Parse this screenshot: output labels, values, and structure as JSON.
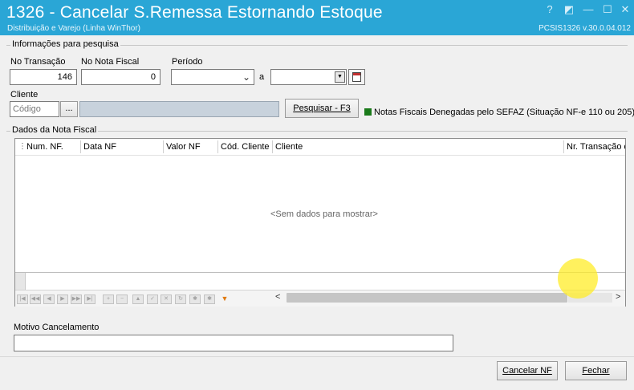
{
  "window": {
    "title": "1326 - Cancelar S.Remessa Estornando Estoque",
    "subtitle": "Distribuição e Varejo (Linha WinThor)",
    "version": "PCSIS1326  v.30.0.04.012",
    "controls": [
      "?",
      "◩",
      "—",
      "☐",
      "✕"
    ]
  },
  "search": {
    "group_label": "Informações para pesquisa",
    "transacao_label": "No Transação",
    "transacao_value": "146",
    "nota_label": "No Nota Fiscal",
    "nota_value": "0",
    "periodo_label": "Período",
    "periodo_sep": "a",
    "cliente_label": "Cliente",
    "cliente_placeholder": "Código",
    "ellipsis": "...",
    "pesquisar_label": "Pesquisar - F3",
    "legend_text": "Notas Fiscais Denegadas pelo SEFAZ (Situação NF-e 110 ou 205)",
    "legend_color": "#1a7a1a"
  },
  "grid": {
    "group_label": "Dados da Nota Fiscal",
    "columns": [
      "Num. NF.",
      "Data NF",
      "Valor NF",
      "Cód. Cliente",
      "Cliente",
      "Nr. Transação d"
    ],
    "empty_text": "<Sem dados para mostrar>",
    "scroll_left": "<",
    "scroll_right": ">"
  },
  "motivo": {
    "label": "Motivo Cancelamento",
    "value": ""
  },
  "footer": {
    "cancelar_label": "Cancelar NF",
    "fechar_label": "Fechar"
  }
}
